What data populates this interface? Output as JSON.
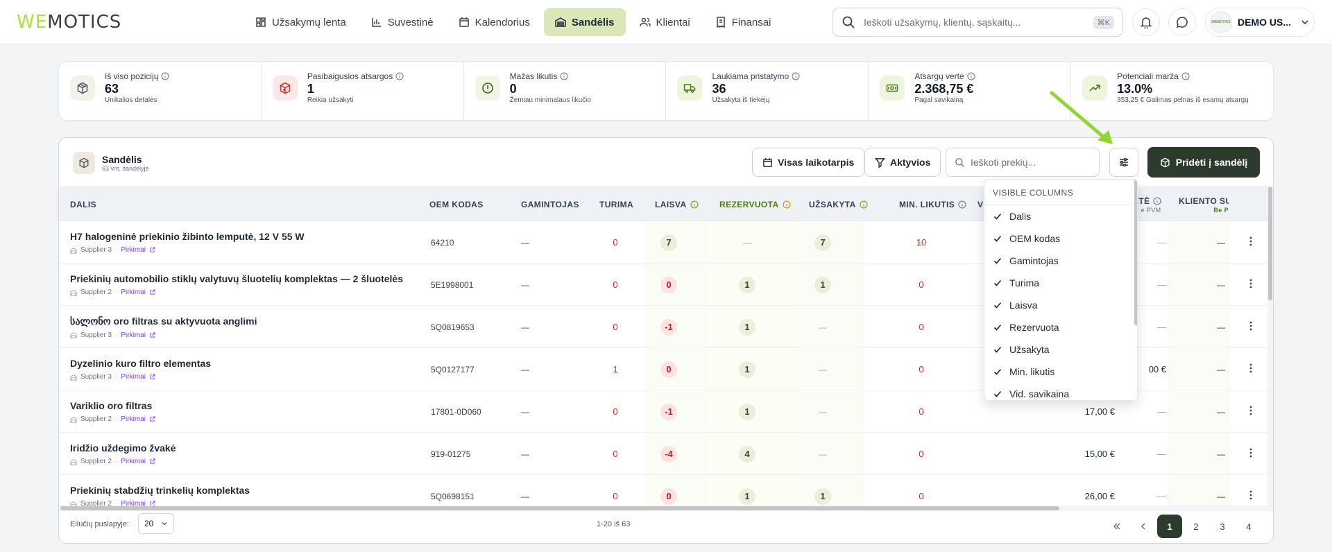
{
  "app": {
    "logo_left": "WE",
    "logo_right": "MOTICS"
  },
  "nav": {
    "items": [
      {
        "label": "Užsakymų lenta",
        "icon": "dashboard-grid-icon",
        "active": false
      },
      {
        "label": "Suvestinė",
        "icon": "bar-chart-icon",
        "active": false
      },
      {
        "label": "Kalendorius",
        "icon": "calendar-icon",
        "active": false
      },
      {
        "label": "Sandėlis",
        "icon": "warehouse-icon",
        "active": true
      },
      {
        "label": "Klientai",
        "icon": "users-icon",
        "active": false
      },
      {
        "label": "Finansai",
        "icon": "receipt-icon",
        "active": false
      }
    ],
    "search_placeholder": "Ieškoti užsakymų, klientų, sąskaitų...",
    "search_shortcut": "⌘K",
    "user_name": "DEMO US...",
    "avatar_text": "WEMOTICS"
  },
  "stats": [
    {
      "label": "Iš viso pozicijų",
      "value": "63",
      "sub": "Unikalios detalės",
      "icon": "box-icon",
      "color": "#4b5563",
      "bg": "#f3f1ea"
    },
    {
      "label": "Pasibaigusios atsargos",
      "value": "1",
      "sub": "Reikia užsakyti",
      "icon": "box-alert-icon",
      "color": "#dc2626",
      "bg": "#fde8e8"
    },
    {
      "label": "Mažas likutis",
      "value": "0",
      "sub": "Žemiau minimalaus likučio",
      "icon": "alert-circle-icon",
      "color": "#3f6212",
      "bg": "#f1f5e4"
    },
    {
      "label": "Laukiama pristatymo",
      "value": "36",
      "sub": "Užsakyta iš tiekėjų",
      "icon": "truck-icon",
      "color": "#4d7c0f",
      "bg": "#eef5dc"
    },
    {
      "label": "Atsargų vertė",
      "value": "2.368,75 €",
      "sub": "Pagal savikainą",
      "icon": "banknote-icon",
      "color": "#4d7c0f",
      "bg": "#eef5dc"
    },
    {
      "label": "Potenciali marža",
      "value": "13.0%",
      "sub": "353,25 € Galimas pelnas iš esamų atsargų",
      "icon": "trending-up-icon",
      "color": "#4d7c0f",
      "bg": "#eef5dc"
    }
  ],
  "panel": {
    "title": "Sandėlis",
    "subtitle": "63 vnt. sandėlyje",
    "period_button": "Visas laikotarpis",
    "filter_button": "Aktyvios",
    "search_placeholder": "Ieškoti prekių...",
    "add_button": "Pridėti į sandėlį"
  },
  "columns": {
    "dalis": "DALIS",
    "oem": "OEM KODAS",
    "gamintojas": "GAMINTOJAS",
    "turima": "TURIMA",
    "laisva": "LAISVA",
    "rezervuota": "REZERVUOTA",
    "uzsakyta": "UŽSAKYTA",
    "min": "MIN. LIKUTIS",
    "vid_partial": "V",
    "verte_partial": "ĖTĖ",
    "verte_sub": "e PVM",
    "kliento": "KLIENTO SUI",
    "kliento_sub": "Be P"
  },
  "rows": [
    {
      "name": "H7 halogeninė priekinio žibinto lemputė, 12 V 55 W",
      "supplier": "Supplier 3",
      "link": "Pirkimai",
      "oem": "64210",
      "gamintojas": "—",
      "turima": "0",
      "laisva": "7",
      "laisva_type": "g",
      "rezervuota": "—",
      "rez_type": "dash",
      "uzsakyta": "7",
      "uz_type": "g",
      "min": "10",
      "vid": "",
      "verte": "—",
      "kliento": "—"
    },
    {
      "name": "Priekinių automobilio stiklų valytuvų šluotelių komplektas — 2 šluotelės",
      "supplier": "Supplier 2",
      "link": "Pirkimai",
      "oem": "5E1998001",
      "gamintojas": "—",
      "turima": "0",
      "laisva": "0",
      "laisva_type": "r",
      "rezervuota": "1",
      "rez_type": "g",
      "uzsakyta": "1",
      "uz_type": "g",
      "min": "0",
      "vid": "",
      "verte": "—",
      "kliento": "—"
    },
    {
      "name": "სალონო oro filtras su aktyvuota anglimi",
      "supplier": "Supplier 3",
      "link": "Pirkimai",
      "oem": "5Q0819653",
      "gamintojas": "—",
      "turima": "0",
      "laisva": "-1",
      "laisva_type": "r",
      "rezervuota": "1",
      "rez_type": "g",
      "uzsakyta": "—",
      "uz_type": "dash",
      "min": "0",
      "vid": "",
      "verte": "—",
      "kliento": "—"
    },
    {
      "name": "Dyzelinio kuro filtro elementas",
      "supplier": "Supplier 3",
      "link": "Pirkimai",
      "oem": "5Q0127177",
      "gamintojas": "—",
      "turima": "1",
      "laisva": "0",
      "laisva_type": "r",
      "rezervuota": "1",
      "rez_type": "g",
      "uzsakyta": "—",
      "uz_type": "dash",
      "min": "0",
      "vid": "",
      "verte": "00 €",
      "kliento": "—"
    },
    {
      "name": "Variklio oro filtras",
      "supplier": "Supplier 2",
      "link": "Pirkimai",
      "oem": "17801-0D060",
      "gamintojas": "—",
      "turima": "0",
      "laisva": "-1",
      "laisva_type": "r",
      "rezervuota": "1",
      "rez_type": "g",
      "uzsakyta": "—",
      "uz_type": "dash",
      "min": "0",
      "vid": "17,00 €",
      "verte": "—",
      "kliento": "—"
    },
    {
      "name": "Iridžio uždegimo žvakė",
      "supplier": "Supplier 2",
      "link": "Pirkimai",
      "oem": "919-01275",
      "gamintojas": "—",
      "turima": "0",
      "laisva": "-4",
      "laisva_type": "r",
      "rezervuota": "4",
      "rez_type": "g",
      "uzsakyta": "—",
      "uz_type": "dash",
      "min": "0",
      "vid": "15,00 €",
      "verte": "—",
      "kliento": "—"
    },
    {
      "name": "Priekinių stabdžių trinkelių komplektas",
      "supplier": "Supplier 2",
      "link": "Pirkimai",
      "oem": "5Q0698151",
      "gamintojas": "—",
      "turima": "0",
      "laisva": "0",
      "laisva_type": "r",
      "rezervuota": "1",
      "rez_type": "g",
      "uzsakyta": "1",
      "uz_type": "g",
      "min": "0",
      "vid": "26,00 €",
      "verte": "—",
      "kliento": "—"
    }
  ],
  "dropdown": {
    "title": "VISIBLE COLUMNS",
    "items": [
      "Dalis",
      "OEM kodas",
      "Gamintojas",
      "Turima",
      "Laisva",
      "Rezervuota",
      "Užsakyta",
      "Min. likutis",
      "Vid. savikaina"
    ]
  },
  "footer": {
    "rows_label": "Eilučių puslapyje:",
    "rows_value": "20",
    "range": "1-20 iš 63",
    "pages": [
      "1",
      "2",
      "3",
      "4"
    ],
    "current_page": "1"
  }
}
